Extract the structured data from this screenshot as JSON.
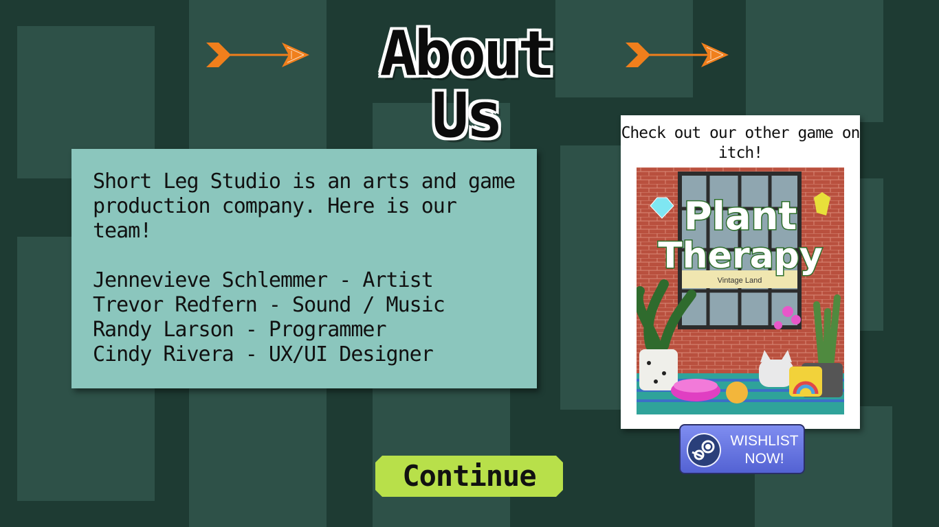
{
  "title": "About Us",
  "info": {
    "intro": "Short Leg Studio is an arts and game production company.  Here is our team!",
    "team": [
      "Jennevieve Schlemmer - Artist",
      "Trevor Redfern - Sound / Music",
      "Randy Larson - Programmer",
      "Cindy Rivera - UX/UI Designer"
    ]
  },
  "promo": {
    "text": "Check out our other game on itch!",
    "cover_title_line1": "Plant",
    "cover_title_line2": "Therapy",
    "cover_sign": "Vintage Land"
  },
  "wishlist": {
    "label": "WISHLIST NOW!"
  },
  "continue": {
    "label": "Continue"
  },
  "colors": {
    "background": "#1e3b33",
    "tile": "#2e5148",
    "panel": "#8bc6bd",
    "continue": "#b8e04a",
    "arrow": "#f07f1c",
    "wishlist": "#6b78e4"
  },
  "icons": [
    "arrow-left-icon",
    "arrow-right-icon",
    "steam-icon"
  ]
}
